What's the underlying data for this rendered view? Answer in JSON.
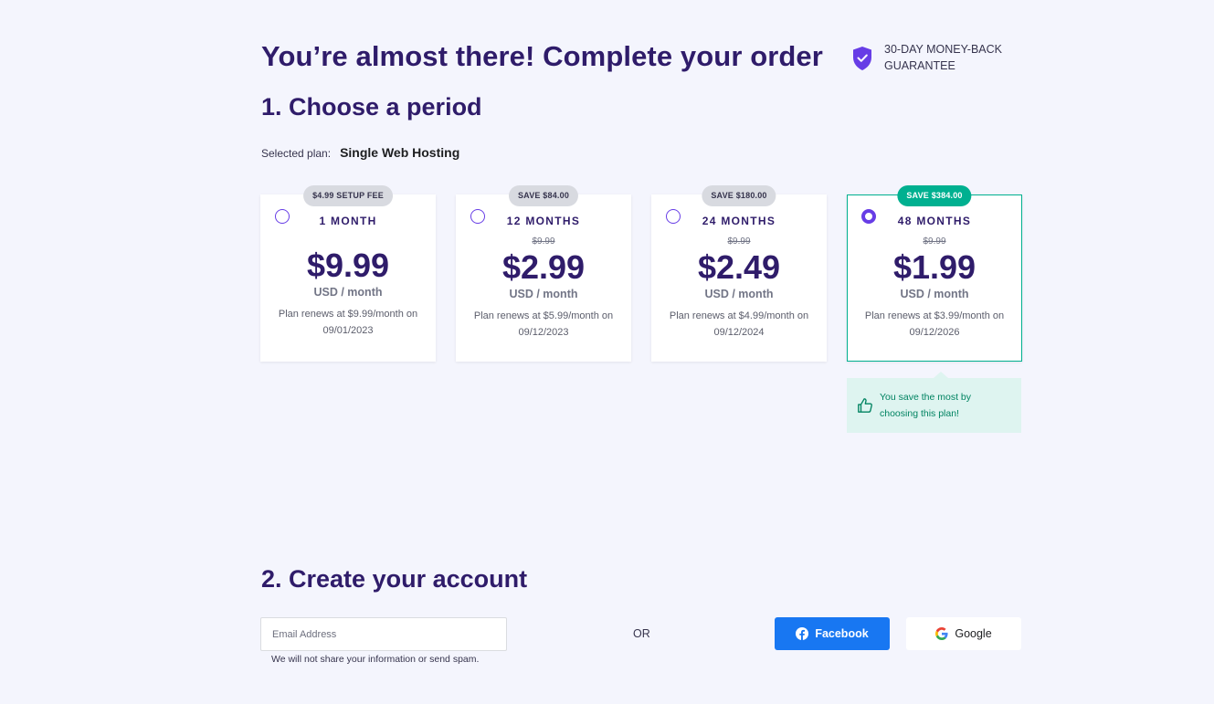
{
  "header": {
    "title": "You’re almost there! Complete your order",
    "guarantee": "30-DAY MONEY-BACK GUARANTEE"
  },
  "period_section": {
    "title": "1. Choose a period",
    "selected_plan_label": "Selected plan:",
    "selected_plan_value": "Single Web Hosting",
    "plans": [
      {
        "badge": "$4.99 SETUP FEE",
        "period": "1 MONTH",
        "old_price": "",
        "price": "$9.99",
        "unit": "USD / month",
        "renew": "Plan renews at $9.99/month on 09/01/2023",
        "selected": false
      },
      {
        "badge": "SAVE $84.00",
        "period": "12 MONTHS",
        "old_price": "$9.99",
        "price": "$2.99",
        "unit": "USD / month",
        "renew": "Plan renews at $5.99/month on 09/12/2023",
        "selected": false
      },
      {
        "badge": "SAVE $180.00",
        "period": "24 MONTHS",
        "old_price": "$9.99",
        "price": "$2.49",
        "unit": "USD / month",
        "renew": "Plan renews at $4.99/month on 09/12/2024",
        "selected": false
      },
      {
        "badge": "SAVE $384.00",
        "period": "48 MONTHS",
        "old_price": "$9.99",
        "price": "$1.99",
        "unit": "USD / month",
        "renew": "Plan renews at $3.99/month on 09/12/2026",
        "selected": true
      }
    ],
    "save_most_message": "You save the most by choosing this plan!"
  },
  "account_section": {
    "title": "2. Create your account",
    "email_placeholder": "Email Address",
    "email_value": "",
    "email_note": "We will not share your information or send spam.",
    "or_label": "OR",
    "facebook_label": "Facebook",
    "google_label": "Google"
  },
  "colors": {
    "primary": "#673de6",
    "heading": "#2f1c6a",
    "success": "#00b090",
    "facebook": "#1877f2",
    "background": "#f4f5fd"
  }
}
